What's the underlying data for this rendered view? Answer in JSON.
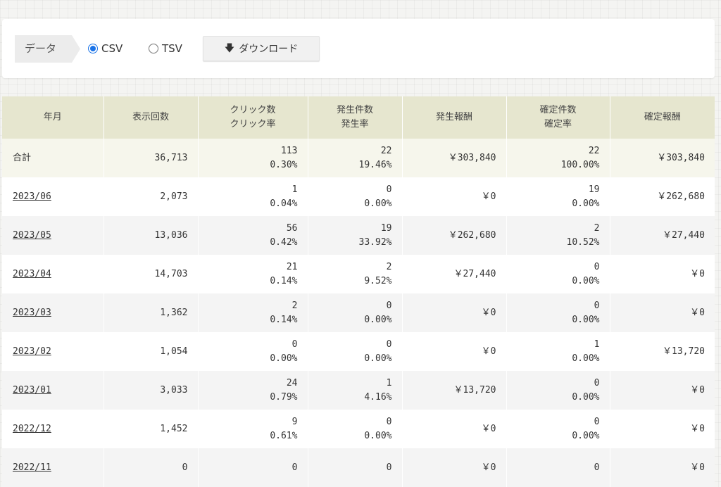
{
  "toolbar": {
    "data_label": "データ",
    "csv_label": "CSV",
    "tsv_label": "TSV",
    "selected_format": "CSV",
    "download_label": "ダウンロード",
    "download_icon": "arrow-down-icon"
  },
  "table": {
    "headers": [
      "年月",
      "表示回数",
      "クリック数\nクリック率",
      "発生件数\n発生率",
      "発生報酬",
      "確定件数\n確定率",
      "確定報酬"
    ],
    "total": {
      "label": "合計",
      "views": "36,713",
      "clicks": "113",
      "click_rate": "0.30%",
      "occurrences": "22",
      "occurrence_rate": "19.46%",
      "occurrence_reward": "￥303,840",
      "confirmed": "22",
      "confirmed_rate": "100.00%",
      "confirmed_reward": "￥303,840"
    },
    "rows": [
      {
        "month": "2023/06",
        "views": "2,073",
        "clicks": "1",
        "click_rate": "0.04%",
        "occurrences": "0",
        "occurrence_rate": "0.00%",
        "occurrence_reward": "￥0",
        "confirmed": "19",
        "confirmed_rate": "0.00%",
        "confirmed_reward": "￥262,680"
      },
      {
        "month": "2023/05",
        "views": "13,036",
        "clicks": "56",
        "click_rate": "0.42%",
        "occurrences": "19",
        "occurrence_rate": "33.92%",
        "occurrence_reward": "￥262,680",
        "confirmed": "2",
        "confirmed_rate": "10.52%",
        "confirmed_reward": "￥27,440"
      },
      {
        "month": "2023/04",
        "views": "14,703",
        "clicks": "21",
        "click_rate": "0.14%",
        "occurrences": "2",
        "occurrence_rate": "9.52%",
        "occurrence_reward": "￥27,440",
        "confirmed": "0",
        "confirmed_rate": "0.00%",
        "confirmed_reward": "￥0"
      },
      {
        "month": "2023/03",
        "views": "1,362",
        "clicks": "2",
        "click_rate": "0.14%",
        "occurrences": "0",
        "occurrence_rate": "0.00%",
        "occurrence_reward": "￥0",
        "confirmed": "0",
        "confirmed_rate": "0.00%",
        "confirmed_reward": "￥0"
      },
      {
        "month": "2023/02",
        "views": "1,054",
        "clicks": "0",
        "click_rate": "0.00%",
        "occurrences": "0",
        "occurrence_rate": "0.00%",
        "occurrence_reward": "￥0",
        "confirmed": "1",
        "confirmed_rate": "0.00%",
        "confirmed_reward": "￥13,720"
      },
      {
        "month": "2023/01",
        "views": "3,033",
        "clicks": "24",
        "click_rate": "0.79%",
        "occurrences": "1",
        "occurrence_rate": "4.16%",
        "occurrence_reward": "￥13,720",
        "confirmed": "0",
        "confirmed_rate": "0.00%",
        "confirmed_reward": "￥0"
      },
      {
        "month": "2022/12",
        "views": "1,452",
        "clicks": "9",
        "click_rate": "0.61%",
        "occurrences": "0",
        "occurrence_rate": "0.00%",
        "occurrence_reward": "￥0",
        "confirmed": "0",
        "confirmed_rate": "0.00%",
        "confirmed_reward": "￥0"
      },
      {
        "month": "2022/11",
        "views": "0",
        "clicks": "0",
        "click_rate": "",
        "occurrences": "0",
        "occurrence_rate": "",
        "occurrence_reward": "￥0",
        "confirmed": "0",
        "confirmed_rate": "",
        "confirmed_reward": "￥0"
      }
    ]
  },
  "colors": {
    "header_bg": "#e6e6cf",
    "total_bg": "#f6f6ec",
    "radio_accent": "#1a73e8"
  }
}
